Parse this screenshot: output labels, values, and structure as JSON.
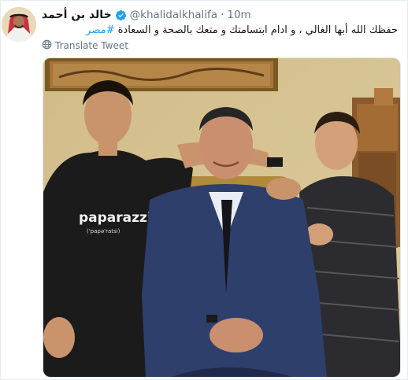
{
  "tweet": {
    "author_name": "خالد بن أحمد",
    "handle": "@khalidalkhalifa",
    "separator": "·",
    "timestamp": "10m",
    "text": "حفظك الله أبها الغالي ، و ادام ابتسامتك و متعك بالصحة و السعادة",
    "hashtag": "#مصر",
    "translate_label": "Translate Tweet"
  },
  "photo": {
    "shirt_text": "paparazzi",
    "shirt_subtext": "('papə'ratsi)"
  },
  "colors": {
    "accent": "#1da1f2",
    "secondary_text": "#657786",
    "wall": "#d8c595",
    "suit": "#2f3f6b"
  }
}
